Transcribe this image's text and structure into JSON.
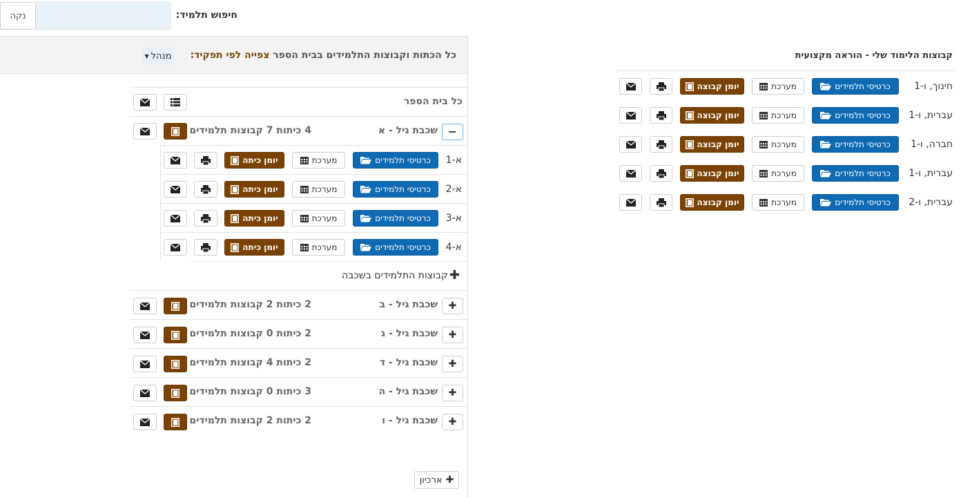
{
  "search": {
    "label": "חיפוש תלמיד:",
    "clear_button": "נקה",
    "placeholder": ""
  },
  "panel": {
    "header_text": "כל הכתות וקבוצות התלמידים בבית הספר",
    "view_by_role_label": "צפייה לפי תפקיד:",
    "role_dropdown_value": "מנהל",
    "whole_school_label": "כל בית הספר",
    "grades": [
      {
        "name": "שכבת גיל - א",
        "summary": "4 כיתות 7 קבוצות תלמידים",
        "expanded": true
      },
      {
        "name": "שכבת גיל - ב",
        "summary": "2 כיתות 2 קבוצות תלמידים",
        "expanded": false
      },
      {
        "name": "שכבת גיל - ג",
        "summary": "2 כיתות 0 קבוצות תלמידים",
        "expanded": false
      },
      {
        "name": "שכבת גיל - ד",
        "summary": "2 כיתות 4 קבוצות תלמידים",
        "expanded": false
      },
      {
        "name": "שכבת גיל - ה",
        "summary": "3 כיתות 0 קבוצות תלמידים",
        "expanded": false
      },
      {
        "name": "שכבת גיל - ו",
        "summary": "2 כיתות 2 קבוצות תלמידים",
        "expanded": false
      }
    ],
    "classes": [
      {
        "name": "א-1"
      },
      {
        "name": "א-2"
      },
      {
        "name": "א-3"
      },
      {
        "name": "א-4"
      }
    ],
    "class_buttons": {
      "student_cards": "כרטיסי תלמידים",
      "schedule": "מערכת",
      "class_diary": "יומן כיתה"
    },
    "grade_groups_label": "קבוצות התלמידים בשכבה",
    "archive_button": "ארכיון"
  },
  "my_groups": {
    "title": "קבוצות הלימוד שלי - הוראה מקצועית",
    "buttons": {
      "student_cards": "כרטיסי תלמידים",
      "schedule": "מערכת",
      "group_diary": "יומן קבוצה"
    },
    "groups": [
      {
        "name": "חינוך, ו-1"
      },
      {
        "name": "עברית, ו-1"
      },
      {
        "name": "חברה, ו-1"
      },
      {
        "name": "עברית, ו-1"
      },
      {
        "name": "עברית, ו-2"
      }
    ]
  },
  "colors": {
    "primary_blue": "#0f6ab4",
    "diary_brown": "#7a4203",
    "search_bg": "#e7f1f8",
    "header_bg": "#f3f3f3"
  },
  "icons": {
    "mail": "envelope-icon",
    "print": "printer-icon",
    "list": "list-icon",
    "book": "book-icon",
    "folder": "folder-open-icon",
    "calendar": "calendar-icon",
    "plus": "plus-icon",
    "minus": "minus-icon"
  }
}
